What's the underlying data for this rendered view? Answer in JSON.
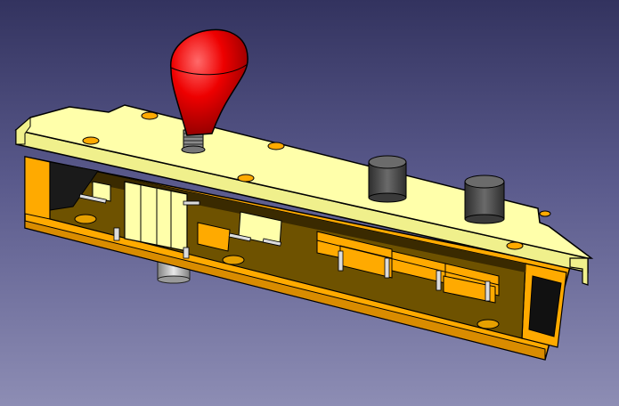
{
  "viewport": {
    "background_top": "#33335F",
    "background_bottom": "#8D8DB4"
  },
  "model": {
    "colors": {
      "pcb_top": "#FFFFAA",
      "pcb_edge": "#F0F08C",
      "case": "#FFAA00",
      "case_dark": "#D98C00",
      "case_floor": "#6E5200",
      "knob": "#EE0000",
      "knob_highlight": "#FF5555",
      "shaft": "#9A9A9A",
      "button": "#4A4A4A",
      "pin": "#DCDCDC"
    },
    "icons": [
      "joystick-knob",
      "push-button",
      "mounting-hole",
      "micro-switch"
    ]
  }
}
